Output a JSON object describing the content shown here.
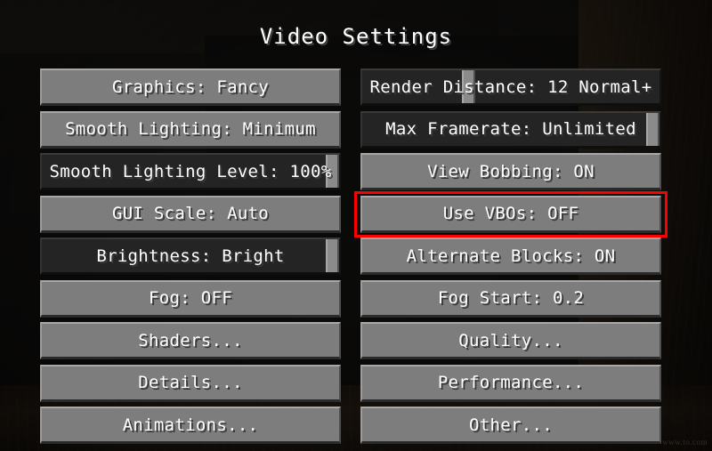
{
  "screen": {
    "title": "Video Settings",
    "accent_highlight_color": "#ff0000",
    "button_color": "#7d7d7d",
    "slider_track_color": "#242424",
    "text_color": "#ffffff"
  },
  "watermark": {
    "text": "www.to.com"
  },
  "left_column": [
    {
      "label": "Graphics: Fancy",
      "type": "button"
    },
    {
      "label": "Smooth Lighting: Minimum",
      "type": "button"
    },
    {
      "label": "Smooth Lighting Level: 100%",
      "type": "slider",
      "handle_pct": 100
    },
    {
      "label": "GUI Scale: Auto",
      "type": "button"
    },
    {
      "label": "Brightness: Bright",
      "type": "slider",
      "handle_pct": 100
    },
    {
      "label": "Fog: OFF",
      "type": "button"
    },
    {
      "label": "Shaders...",
      "type": "button"
    },
    {
      "label": "Details...",
      "type": "button"
    },
    {
      "label": "Animations...",
      "type": "button"
    }
  ],
  "right_column": [
    {
      "label": "Render Distance: 12 Normal+",
      "type": "slider",
      "handle_pct": 35
    },
    {
      "label": "Max Framerate: Unlimited",
      "type": "slider",
      "handle_pct": 100
    },
    {
      "label": "View Bobbing: ON",
      "type": "button"
    },
    {
      "label": "Use VBOs: OFF",
      "type": "button",
      "highlighted": true
    },
    {
      "label": "Alternate Blocks: ON",
      "type": "button"
    },
    {
      "label": "Fog Start: 0.2",
      "type": "button"
    },
    {
      "label": "Quality...",
      "type": "button"
    },
    {
      "label": "Performance...",
      "type": "button"
    },
    {
      "label": "Other...",
      "type": "button"
    }
  ]
}
